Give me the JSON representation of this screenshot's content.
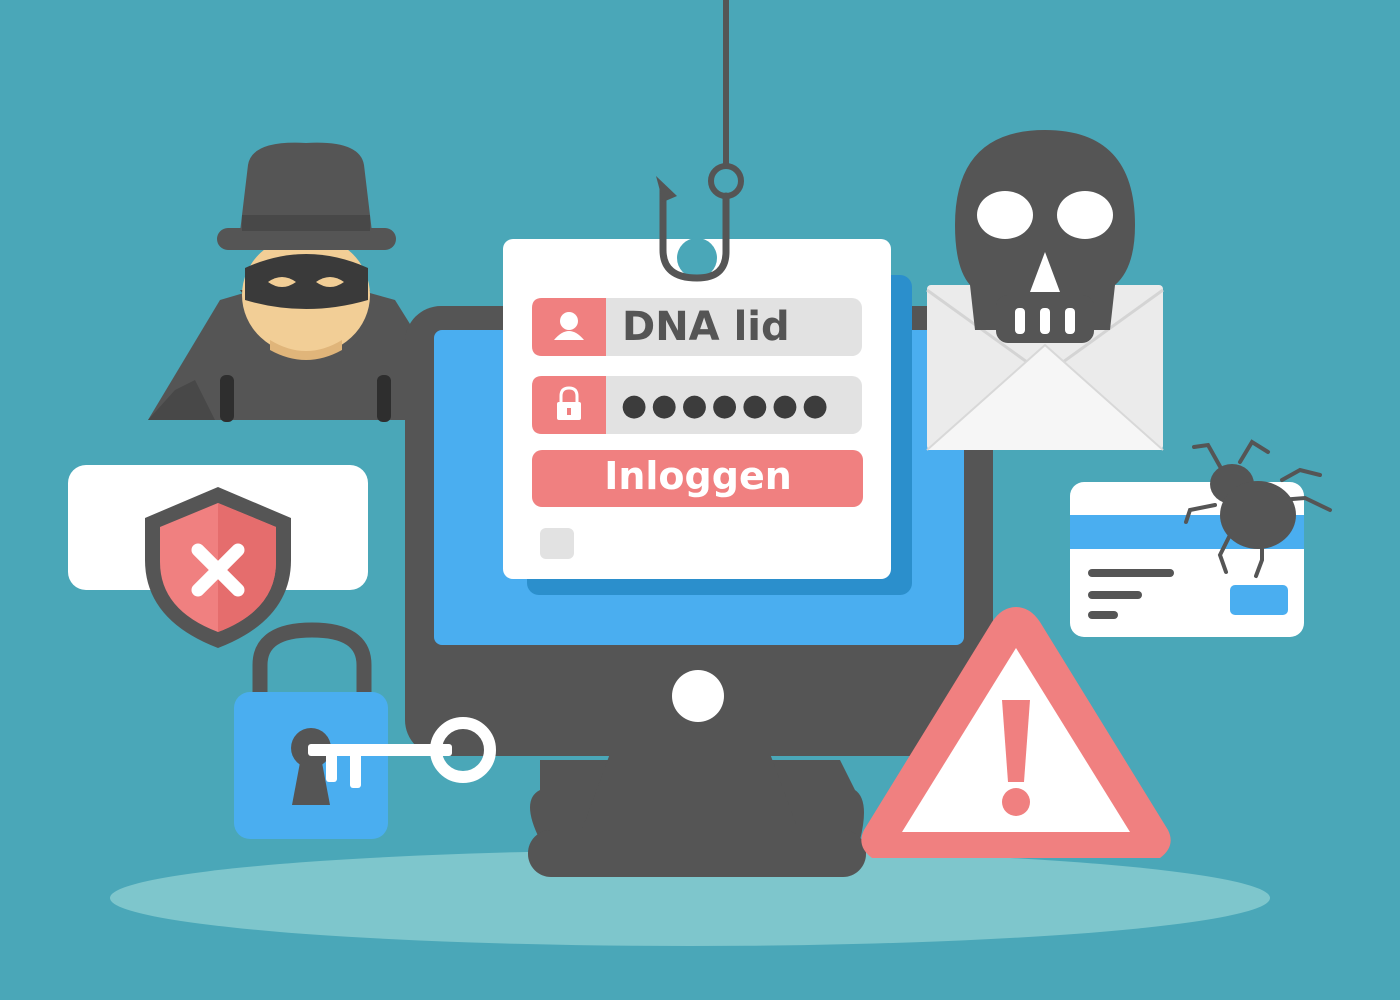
{
  "login_form": {
    "username_value": "DNA lid",
    "password_value": "●●●●●●●",
    "login_button_label": "Inloggen"
  },
  "icons": {
    "user": "user-icon",
    "lock": "lock-icon",
    "hacker": "hacker-icon",
    "skull": "skull-icon",
    "envelope": "envelope-icon",
    "shield": "shield-x-icon",
    "padlock": "padlock-icon",
    "key": "key-icon",
    "warning": "warning-triangle-icon",
    "bug": "bug-icon",
    "credit_card": "credit-card-icon",
    "fishing_hook": "fishing-hook-icon"
  },
  "colors": {
    "background": "#4aa7b8",
    "accent_red": "#f08080",
    "dark": "#555555",
    "screen_blue": "#4aaef0",
    "floor": "#7ec6cc"
  }
}
